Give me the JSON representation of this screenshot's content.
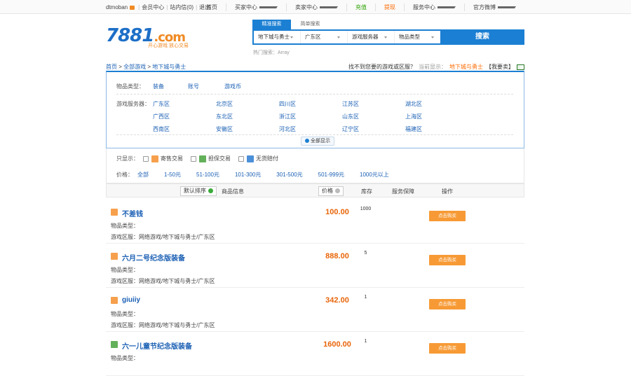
{
  "topbar": {
    "username": "dtmoban",
    "member_center": "会员中心",
    "messages": "站内信(0)",
    "logout": "退出",
    "links": [
      {
        "label": "首页",
        "dropdown": false,
        "style": ""
      },
      {
        "label": "买家中心",
        "dropdown": true,
        "style": ""
      },
      {
        "label": "卖家中心",
        "dropdown": true,
        "style": ""
      },
      {
        "label": "充值",
        "dropdown": false,
        "style": "green"
      },
      {
        "label": "提现",
        "dropdown": false,
        "style": "orange"
      },
      {
        "label": "服务中心",
        "dropdown": true,
        "style": ""
      },
      {
        "label": "官方微博",
        "dropdown": true,
        "style": ""
      }
    ]
  },
  "logo": {
    "text": "7881",
    "suffix": ".com",
    "slogan": "开心游戏 放心交易"
  },
  "search": {
    "tabs": [
      "精准搜索",
      "简单搜索"
    ],
    "fields": [
      "地下城与勇士",
      "广东区",
      "游戏服务器",
      "物品类型"
    ],
    "button": "搜索",
    "hot": "热门搜索：Array"
  },
  "breadcrumb": {
    "home": "首页",
    "all": "全部游戏",
    "current": "地下城与勇士",
    "not_found": "找不到您要的游戏或区服？",
    "showing_label": "当前显示：",
    "showing_value": "地下城与勇士",
    "want_sell": "【我要卖】"
  },
  "filter": {
    "item_type_label": "物品类型：",
    "item_types": [
      "装备",
      "账号",
      "游戏币"
    ],
    "server_label": "游戏服务器：",
    "servers": [
      [
        "广东区",
        "北京区",
        "四川区",
        "江苏区",
        "湖北区"
      ],
      [
        "广西区",
        "东北区",
        "浙江区",
        "山东区",
        "上海区"
      ],
      [
        "西南区",
        "安徽区",
        "河北区",
        "辽宁区",
        "福建区"
      ]
    ],
    "show_all": "全部显示"
  },
  "options": {
    "only_show": "只显示：",
    "checks": [
      {
        "label": "寄售交易",
        "tag": "o"
      },
      {
        "label": "担保交易",
        "tag": "g"
      },
      {
        "label": "无货赔付",
        "tag": "b"
      }
    ],
    "price_label": "价格：",
    "prices": [
      "全部",
      "1-50元",
      "51-100元",
      "101-300元",
      "301-500元",
      "501-999元",
      "1000元以上"
    ]
  },
  "table": {
    "default_sort": "默认排序",
    "product_info": "商品信息",
    "price": "价格",
    "stock": "库存",
    "guarantee": "服务保障",
    "action": "操作"
  },
  "rows": [
    {
      "title": "不差钱",
      "type": "物品类型：",
      "area": "游戏区服：网络游戏/地下城与勇士/广东区",
      "price": "100.00",
      "stock": "1000",
      "buy": "点击购买",
      "tag": "o"
    },
    {
      "title": "六月二号纪念版装备",
      "type": "物品类型：",
      "area": "游戏区服：网络游戏/地下城与勇士/广东区",
      "price": "888.00",
      "stock": "5",
      "buy": "点击购买",
      "tag": "o"
    },
    {
      "title": "giuiiy",
      "type": "物品类型：",
      "area": "游戏区服：网络游戏/地下城与勇士/广东区",
      "price": "342.00",
      "stock": "1",
      "buy": "点击购买",
      "tag": "o"
    },
    {
      "title": "六一儿童节纪念版装备",
      "type": "物品类型：",
      "area": "",
      "price": "1600.00",
      "stock": "1",
      "buy": "点击购买",
      "tag": "g"
    }
  ],
  "colors": {
    "accent": "#1b7fd3",
    "price": "#e8650a",
    "buy": "#f79a35"
  }
}
